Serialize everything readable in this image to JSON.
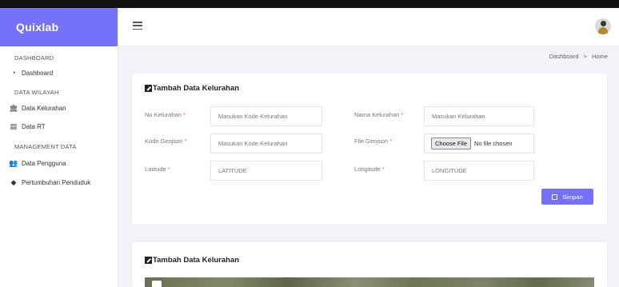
{
  "app": {
    "brand": "Quixlab"
  },
  "sidebar": {
    "sections": {
      "dashboard": "DASHBOARD",
      "wilayah": "DATA WILAYAH",
      "management": "MANAGEMENT DATA"
    },
    "items": [
      {
        "label": "Dashboard",
        "icon": "speedometer-icon"
      },
      {
        "label": "Data Kelurahan",
        "icon": "bank-icon"
      },
      {
        "label": "Data RT",
        "icon": "document-icon"
      },
      {
        "label": "Data Pengguna",
        "icon": "users-icon"
      },
      {
        "label": "Pertumbuhan Penduduk",
        "icon": "chart-icon"
      }
    ]
  },
  "breadcrumb": {
    "parent": "Dashboard",
    "separator": ">",
    "current": "Home"
  },
  "form": {
    "title": "Tambah Data Kelurahan",
    "no_kelurahan": {
      "label": "No Kelurahan",
      "placeholder": "Masukan Kode Kelurahan"
    },
    "nama_kelurahan": {
      "label": "Nama Kelurahan",
      "placeholder": "Masukan Kelurahan"
    },
    "kode_geojson": {
      "label": "Kode Geojson",
      "placeholder": "Masukan Kode Kelurahan"
    },
    "file_geojson": {
      "label": "File Geojson",
      "button": "Choose File",
      "status": "No file chosen"
    },
    "latitude": {
      "label": "Latitude",
      "placeholder": "LATITUDE"
    },
    "longitude": {
      "label": "Longitude",
      "placeholder": "LONGITUDE"
    },
    "required_mark": "*",
    "save_label": "Simpan"
  },
  "map_card": {
    "title": "Tambah Data Kelurahan"
  },
  "colors": {
    "accent": "#7571f9",
    "required": "#ff5e5e",
    "background": "#f3f3f9"
  }
}
